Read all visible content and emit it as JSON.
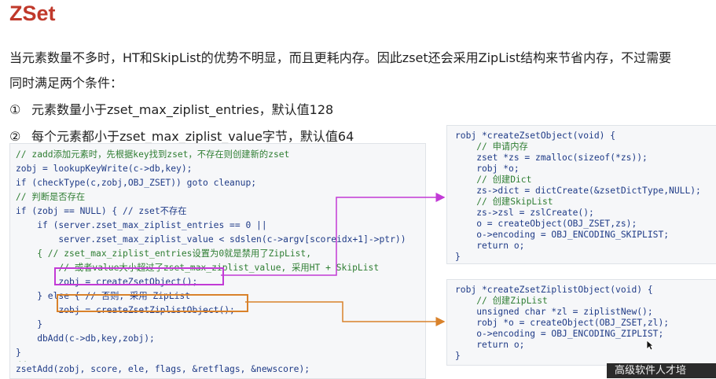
{
  "title": "ZSet",
  "paragraph": {
    "line1": "当元素数量不多时，HT和SkipList的优势不明显，而且更耗内存。因此zset还会采用ZipList结构来节省内存，不过需要",
    "line2": "同时满足两个条件："
  },
  "conditions": [
    {
      "num": "①",
      "text": "元素数量小于zset_max_ziplist_entries，默认值128"
    },
    {
      "num": "②",
      "text": "每个元素都小于zset_max_ziplist_value字节，默认值64"
    }
  ],
  "main_code": [
    "// zadd添加元素时，先根据key找到zset，不存在则创建新的zset",
    "zobj = lookupKeyWrite(c->db,key);",
    "if (checkType(c,zobj,OBJ_ZSET)) goto cleanup;",
    "// 判断是否存在",
    "if (zobj == NULL) { // zset不存在",
    "    if (server.zset_max_ziplist_entries == 0 ||",
    "        server.zset_max_ziplist_value < sdslen(c->argv[scoreidx+1]->ptr))",
    "    { // zset_max_ziplist_entries设置为0就是禁用了ZipList,",
    "        // 或者value大小超过了zset_max_ziplist_value, 采用HT + SkipList",
    "        zobj = createZsetObject();",
    "    } else { // 否则, 采用 ZipList",
    "        zobj = createZsetZiplistObject();",
    "    }",
    "    dbAdd(c->db,key,zobj);",
    "}",
    "// ....",
    "zsetAdd(zobj, score, ele, flags, &retflags, &newscore);"
  ],
  "zset_code": [
    "robj *createZsetObject(void) {",
    "    // 申请内存",
    "    zset *zs = zmalloc(sizeof(*zs));",
    "    robj *o;",
    "    // 创建Dict",
    "    zs->dict = dictCreate(&zsetDictType,NULL);",
    "    // 创建SkipList",
    "    zs->zsl = zslCreate();",
    "    o = createObject(OBJ_ZSET,zs);",
    "    o->encoding = OBJ_ENCODING_SKIPLIST;",
    "    return o;",
    "}"
  ],
  "ziplist_code": [
    "robj *createZsetZiplistObject(void) {",
    "    // 创建ZipList",
    "    unsigned char *zl = ziplistNew();",
    "    robj *o = createObject(OBJ_ZSET,zl);",
    "    o->encoding = OBJ_ENCODING_ZIPLIST;",
    "    return o;",
    "}"
  ],
  "watermark": "高级软件人才培",
  "colors": {
    "title": "#c0392b",
    "code_text": "#1f3b87",
    "comment": "#2e7d32",
    "highlight_purple": "#c23ad6",
    "highlight_orange": "#d9822b",
    "code_bg": "#f6f7f9"
  }
}
